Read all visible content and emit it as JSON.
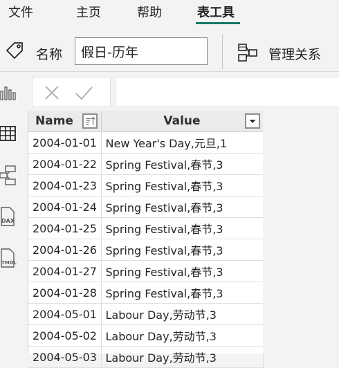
{
  "tabs": [
    {
      "label": "文件",
      "active": false
    },
    {
      "label": "主页",
      "active": false
    },
    {
      "label": "帮助",
      "active": false
    },
    {
      "label": "表工具",
      "active": true
    }
  ],
  "ribbon": {
    "name_label": "名称",
    "name_value": "假日-历年",
    "manage_relationships_label": "管理关系"
  },
  "rail_icons": [
    "report-view-icon",
    "table-view-icon",
    "model-view-icon",
    "dax-query-view-icon",
    "tmdl-view-icon"
  ],
  "formula_bar": {
    "cancel_icon": "close-icon",
    "commit_icon": "check-icon",
    "value": ""
  },
  "table": {
    "columns": [
      "Name",
      "Value"
    ],
    "rows": [
      [
        "2004-01-01",
        "New Year's Day,元旦,1"
      ],
      [
        "2004-01-22",
        "Spring Festival,春节,3"
      ],
      [
        "2004-01-23",
        "Spring Festival,春节,3"
      ],
      [
        "2004-01-24",
        "Spring Festival,春节,3"
      ],
      [
        "2004-01-25",
        "Spring Festival,春节,3"
      ],
      [
        "2004-01-26",
        "Spring Festival,春节,3"
      ],
      [
        "2004-01-27",
        "Spring Festival,春节,3"
      ],
      [
        "2004-01-28",
        "Spring Festival,春节,3"
      ],
      [
        "2004-05-01",
        "Labour Day,劳动节,3"
      ],
      [
        "2004-05-02",
        "Labour Day,劳动节,3"
      ],
      [
        "2004-05-03",
        "Labour Day,劳动节,3"
      ]
    ]
  },
  "colors": {
    "accent": "#117865",
    "background": "#f3f3f3",
    "header_bg": "#ebebeb"
  }
}
